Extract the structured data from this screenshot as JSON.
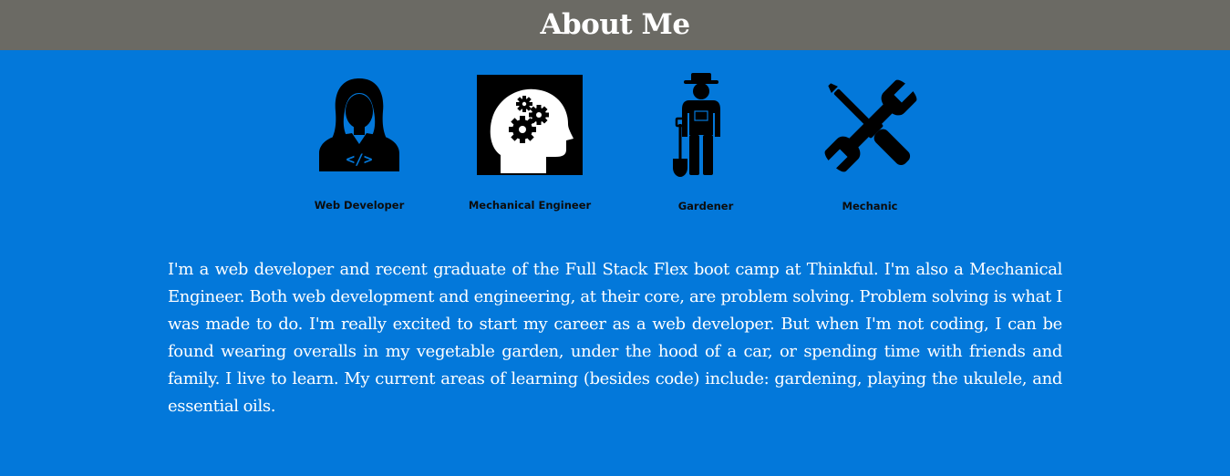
{
  "header": {
    "title": "About Me"
  },
  "roles": [
    {
      "label": "Web Developer",
      "icon": "web-developer-icon"
    },
    {
      "label": "Mechanical Engineer",
      "icon": "mechanical-engineer-icon"
    },
    {
      "label": "Gardener",
      "icon": "gardener-icon"
    },
    {
      "label": "Mechanic",
      "icon": "mechanic-icon"
    }
  ],
  "bio": "I'm a web developer and recent graduate of the Full Stack Flex boot camp at Thinkful. I'm also a Mechanical Engineer. Both web development and engineering, at their core, are problem solving. Problem solving is what I was made to do. I'm really excited to start my career as a web developer. But when I'm not coding, I can be found wearing overalls in my vegetable garden, under the hood of a car, or spending time with friends and family. I live to learn. My current areas of learning (besides code) include: gardening, playing the ukulele, and essential oils.",
  "colors": {
    "background": "#0378da",
    "header": "#6b6a64",
    "text": "#ffffff",
    "icon": "#000000"
  }
}
